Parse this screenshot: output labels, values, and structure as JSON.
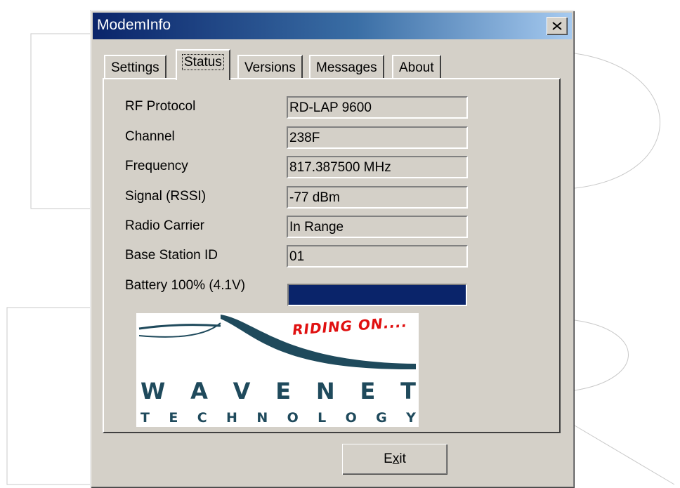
{
  "window": {
    "title": "ModemInfo"
  },
  "tabs": [
    {
      "label": "Settings",
      "active": false
    },
    {
      "label": "Status",
      "active": true
    },
    {
      "label": "Versions",
      "active": false
    },
    {
      "label": "Messages",
      "active": false
    },
    {
      "label": "About",
      "active": false
    }
  ],
  "status": {
    "rows": [
      {
        "label": "RF Protocol",
        "value": "RD-LAP 9600"
      },
      {
        "label": "Channel",
        "value": "238F"
      },
      {
        "label": "Frequency",
        "value": "817.387500 MHz"
      },
      {
        "label": "Signal (RSSI)",
        "value": "-77 dBm"
      },
      {
        "label": "Radio Carrier",
        "value": "In Range"
      },
      {
        "label": "Base Station ID",
        "value": "01"
      }
    ],
    "battery_label": "Battery 100% (4.1V)",
    "battery_level_percent": 100
  },
  "logo": {
    "tagline": "RIDING ON....",
    "line1_letters": [
      "W",
      "A",
      "V",
      "E",
      "N",
      "E",
      "T"
    ],
    "line2_letters": [
      "T",
      "E",
      "C",
      "H",
      "N",
      "O",
      "L",
      "O",
      "G",
      "Y"
    ]
  },
  "buttons": {
    "exit_prefix": "E",
    "exit_mnemonic": "x",
    "exit_suffix": "it"
  },
  "colors": {
    "title_start": "#0a246a",
    "title_end": "#a6caf0",
    "battery_fill": "#0a246a",
    "logo_blue": "#1f4a5c",
    "tagline_red": "#e01010"
  }
}
